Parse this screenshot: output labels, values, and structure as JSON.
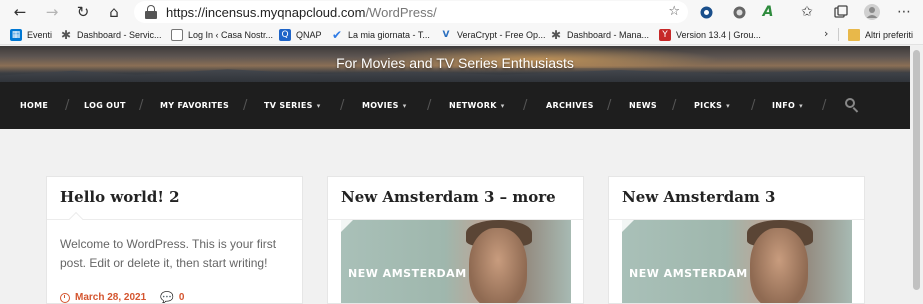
{
  "browser": {
    "url_host": "https://incensus.myqnapcloud.com",
    "url_path": "/WordPress/"
  },
  "bookmarks": {
    "items": [
      {
        "label": "Eventi",
        "icon": "calendar-icon",
        "color": "#0078d4"
      },
      {
        "label": "Dashboard - Servic...",
        "icon": "asterisk-icon",
        "color": "#555555"
      },
      {
        "label": "Log In ‹ Casa Nostr...",
        "icon": "document-icon",
        "color": "#777777"
      },
      {
        "label": "QNAP",
        "icon": "qnap-icon",
        "color": "#1e64c8"
      },
      {
        "label": "La mia giornata - T...",
        "icon": "check-icon",
        "color": "#2f7be5"
      },
      {
        "label": "VeraCrypt - Free Op...",
        "icon": "veracrypt-icon",
        "color": "#2a6fbf"
      },
      {
        "label": "Dashboard - Mana...",
        "icon": "asterisk-icon",
        "color": "#555555"
      },
      {
        "label": "Version 13.4 | Grou...",
        "icon": "version-icon",
        "color": "#c62828"
      }
    ],
    "other_label": "Altri preferiti"
  },
  "site": {
    "tagline": "For Movies and TV Series Enthusiasts"
  },
  "menu": {
    "items": [
      {
        "label": "HOME",
        "dropdown": false
      },
      {
        "label": "LOG OUT",
        "dropdown": false
      },
      {
        "label": "MY FAVORITES",
        "dropdown": false
      },
      {
        "label": "TV SERIES",
        "dropdown": true
      },
      {
        "label": "MOVIES",
        "dropdown": true
      },
      {
        "label": "NETWORK",
        "dropdown": true
      },
      {
        "label": "ARCHIVES",
        "dropdown": false
      },
      {
        "label": "NEWS",
        "dropdown": false
      },
      {
        "label": "PICKS",
        "dropdown": true
      },
      {
        "label": "INFO",
        "dropdown": true
      }
    ],
    "separator": "/",
    "caret": "▾"
  },
  "posts": [
    {
      "title": "Hello world! 2",
      "excerpt": "Welcome to WordPress. This is your first post. Edit or delete it, then start writing!",
      "date": "March 28, 2021",
      "comments": "0"
    },
    {
      "title": "New Amsterdam 3 – more",
      "image_text": "NEW AMSTERDAM"
    },
    {
      "title": "New Amsterdam 3",
      "image_text": "NEW AMSTERDAM"
    }
  ],
  "colors": {
    "accent": "#d4552f",
    "menu_bg": "#1e1e1e",
    "page_bg": "#f1f1f1"
  }
}
